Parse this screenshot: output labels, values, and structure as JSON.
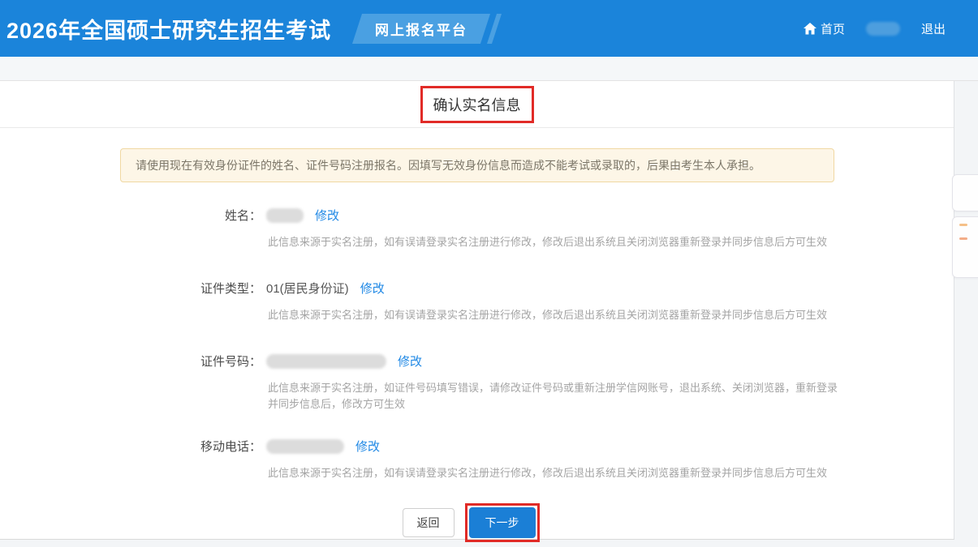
{
  "header": {
    "title": "2026年全国硕士研究生招生考试",
    "badge": "网上报名平台",
    "home_label": "首页",
    "logout_label": "退出",
    "username_redacted": true
  },
  "page": {
    "title": "确认实名信息"
  },
  "notice": "请使用现在有效身份证件的姓名、证件号码注册报名。因填写无效身份信息而造成不能考试或录取的，后果由考生本人承担。",
  "fields": [
    {
      "label": "姓名：",
      "value": "",
      "redacted": true,
      "modify_label": "修改",
      "helper": "此信息来源于实名注册，如有误请登录实名注册进行修改，修改后退出系统且关闭浏览器重新登录并同步信息后方可生效"
    },
    {
      "label": "证件类型：",
      "value": "01(居民身份证)",
      "redacted": false,
      "modify_label": "修改",
      "helper": "此信息来源于实名注册，如有误请登录实名注册进行修改，修改后退出系统且关闭浏览器重新登录并同步信息后方可生效"
    },
    {
      "label": "证件号码：",
      "value": "",
      "redacted": true,
      "modify_label": "修改",
      "helper": "此信息来源于实名注册，如证件号码填写错误，请修改证件号码或重新注册学信网账号，退出系统、关闭浏览器，重新登录并同步信息后，修改方可生效"
    },
    {
      "label": "移动电话：",
      "value": "",
      "redacted": true,
      "modify_label": "修改",
      "helper": "此信息来源于实名注册，如有误请登录实名注册进行修改，修改后退出系统且关闭浏览器重新登录并同步信息后方可生效"
    }
  ],
  "buttons": {
    "back": "返回",
    "next": "下一步"
  },
  "colors": {
    "header_blue": "#1b84da",
    "badge_blue": "#4aa0e2",
    "link_blue": "#1f88e5",
    "primary_button_blue": "#1b7fd6",
    "annotation_red": "#e12b27",
    "notice_bg": "#fdf6e7",
    "notice_border": "#f0d8a2"
  }
}
